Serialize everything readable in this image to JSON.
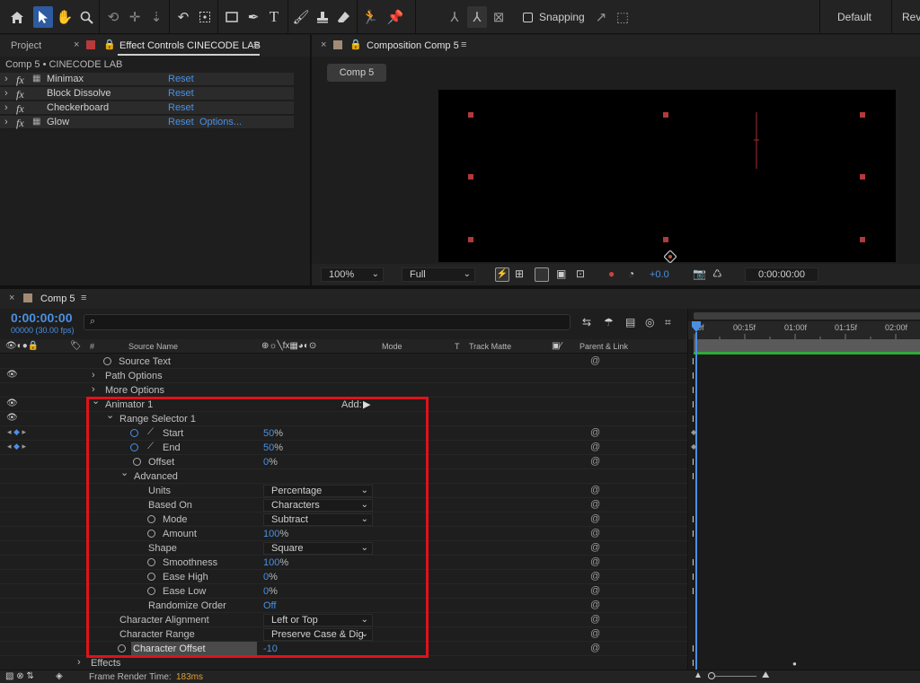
{
  "toolbar": {
    "snapping_label": "Snapping",
    "workspace_default": "Default",
    "workspace_review": "Rev"
  },
  "project_tab": {
    "label": "Project"
  },
  "effect_controls": {
    "tab_label": "Effect Controls CINECODE LAB",
    "header": "Comp 5 • CINECODE LAB",
    "effects": [
      {
        "name": "Minimax",
        "reset": "Reset",
        "options": ""
      },
      {
        "name": "Block Dissolve",
        "reset": "Reset",
        "options": ""
      },
      {
        "name": "Checkerboard",
        "reset": "Reset",
        "options": ""
      },
      {
        "name": "Glow",
        "reset": "Reset",
        "options": "Options..."
      }
    ]
  },
  "composition": {
    "tab_label": "Composition Comp 5",
    "comp_button": "Comp 5",
    "zoom": "100%",
    "resolution": "Full",
    "exposure": "+0.0",
    "timecode": "0:00:00:00"
  },
  "timeline": {
    "tab_label": "Comp 5",
    "timecode": "0:00:00:00",
    "frame_info": "00000 (30.00 fps)",
    "search_placeholder": "",
    "columns": {
      "num": "#",
      "source": "Source Name",
      "mode": "Mode",
      "t": "T",
      "track_matte": "Track Matte",
      "parent": "Parent & Link"
    },
    "ruler": [
      "0f",
      "00:15f",
      "01:00f",
      "01:15f",
      "02:00f"
    ],
    "add_label": "Add:",
    "properties": {
      "source_text": "Source Text",
      "path_options": "Path Options",
      "more_options": "More Options",
      "animator": "Animator 1",
      "range_selector": "Range Selector 1",
      "start": {
        "label": "Start",
        "value": "50",
        "unit": "%"
      },
      "end": {
        "label": "End",
        "value": "50",
        "unit": "%"
      },
      "offset": {
        "label": "Offset",
        "value": "0",
        "unit": "%"
      },
      "advanced": "Advanced",
      "units": {
        "label": "Units",
        "value": "Percentage"
      },
      "based_on": {
        "label": "Based On",
        "value": "Characters"
      },
      "mode": {
        "label": "Mode",
        "value": "Subtract"
      },
      "amount": {
        "label": "Amount",
        "value": "100",
        "unit": "%"
      },
      "shape": {
        "label": "Shape",
        "value": "Square"
      },
      "smoothness": {
        "label": "Smoothness",
        "value": "100",
        "unit": "%"
      },
      "ease_high": {
        "label": "Ease High",
        "value": "0",
        "unit": "%"
      },
      "ease_low": {
        "label": "Ease Low",
        "value": "0",
        "unit": "%"
      },
      "randomize_order": {
        "label": "Randomize Order",
        "value": "Off"
      },
      "character_alignment": {
        "label": "Character Alignment",
        "value": "Left or Top"
      },
      "character_range": {
        "label": "Character Range",
        "value": "Preserve Case & Dig"
      },
      "character_offset": {
        "label": "Character Offset",
        "value": "-10"
      },
      "effects": "Effects"
    },
    "footer": {
      "render_label": "Frame Render Time:",
      "render_value": "183ms"
    }
  },
  "colors": {
    "accent": "#4a90e2",
    "highlight_box": "#e0121b",
    "label_red": "#b83a3a",
    "work_area_green": "#2faa3a"
  }
}
